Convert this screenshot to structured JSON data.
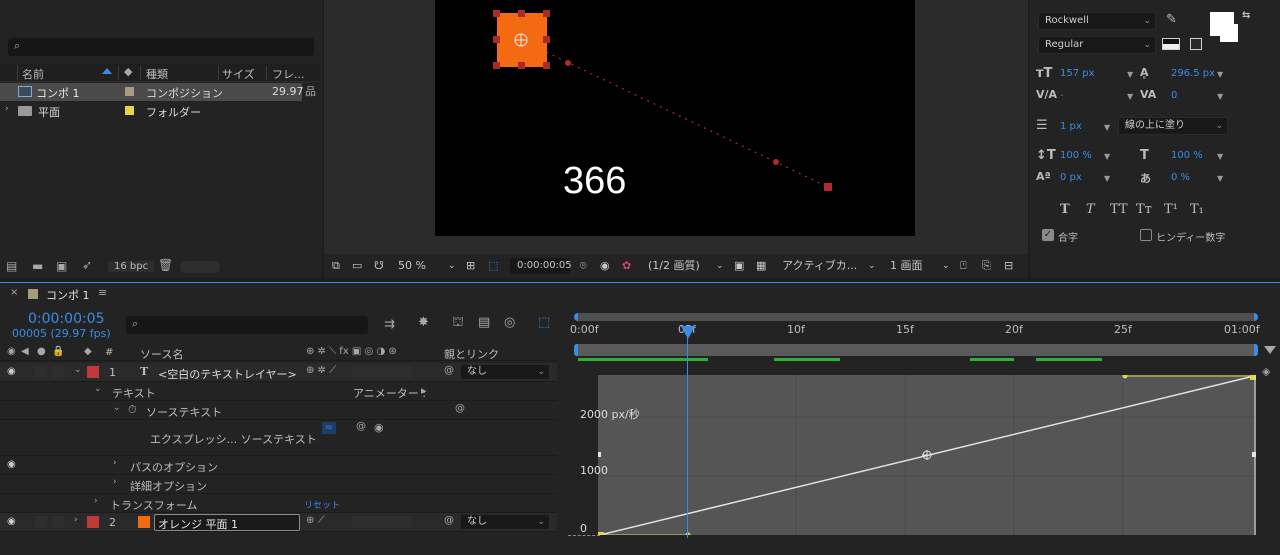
{
  "project": {
    "columns": {
      "name": "名前",
      "type": "種類",
      "size": "サイズ",
      "fps": "フレ..."
    },
    "items": [
      {
        "name": "コンポ 1",
        "type": "コンポジション",
        "fps": "29.97",
        "selected": true
      },
      {
        "name": "平面",
        "type": "フォルダー"
      }
    ],
    "bpc": "16 bpc"
  },
  "viewer": {
    "text": "366",
    "zoom": "50 %",
    "timecode": "0:00:00:05",
    "resolution": "(1/2 画質)",
    "camera": "アクティブカ...",
    "views": "1 画面"
  },
  "character": {
    "font": "Rockwell",
    "style": "Regular",
    "font_size": "157 px",
    "leading": "296.5 px",
    "kerning": "-",
    "tracking": "0",
    "stroke_width": "1 px",
    "stroke_mode": "線の上に塗り",
    "vert_scale": "100 %",
    "horiz_scale": "100 %",
    "baseline_shift": "0 px",
    "tsume": "0 %",
    "ligature": "合字",
    "hindi": "ヒンディー数字",
    "fill_color": "#ffffff",
    "stroke_color": "#ffffff"
  },
  "timeline": {
    "tab": "コンポ 1",
    "timecode": "0:00:00:05",
    "frames": "00005 (29.97 fps)",
    "source_header": "ソース名",
    "parent_header": "親とリンク",
    "layers": [
      {
        "num": "1",
        "name": "<空白のテキストレイヤー>",
        "parent": "なし",
        "color": "#c03a3a"
      },
      {
        "num": "2",
        "name": "オレンジ 平面 1",
        "parent": "なし",
        "color": "#c03a3a",
        "swatch": "#f36a13"
      }
    ],
    "props": {
      "text": "テキスト",
      "animator": "アニメーター :",
      "source_text": "ソーステキスト",
      "expression": "エクスプレッシ... ソーステキスト",
      "path_options": "パスのオプション",
      "more_options": "詳細オプション",
      "transform": "トランスフォーム",
      "reset": "リセット"
    },
    "ruler": [
      "0:00f",
      "05f",
      "10f",
      "15f",
      "20f",
      "25f",
      "01:00f"
    ],
    "graph_labels": [
      "2000 px/秒",
      "1000",
      "0"
    ]
  }
}
